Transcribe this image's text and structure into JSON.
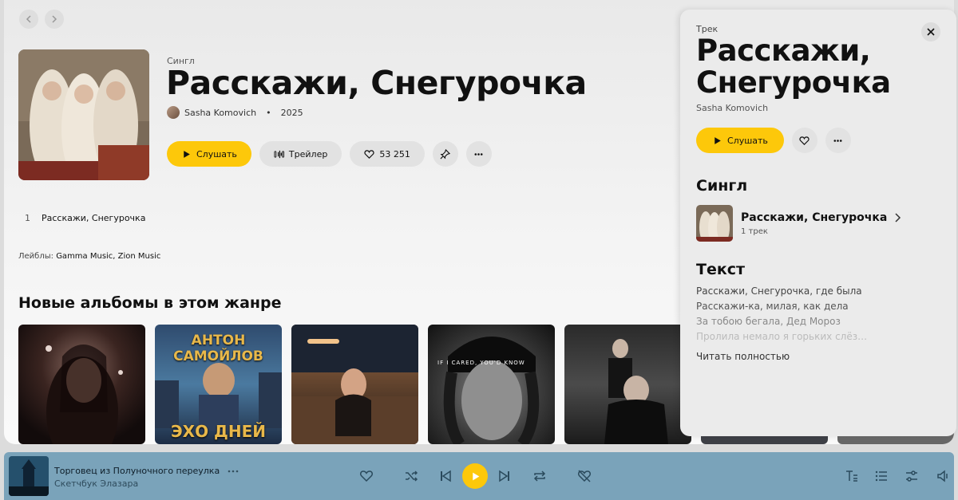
{
  "album": {
    "kicker": "Сингл",
    "title": "Расскажи, Снегурочка",
    "artist": "Sasha Komovich",
    "separator": "•",
    "year": "2025",
    "buttons": {
      "listen": "Слушать",
      "trailer": "Трейлер",
      "likes": "53 251"
    }
  },
  "tracks": [
    {
      "num": "1",
      "title": "Расскажи, Снегурочка"
    }
  ],
  "labels": {
    "prefix": "Лейблы:",
    "names": "Gamma Music, Zion Music"
  },
  "genre_section": {
    "title": "Новые альбомы в этом жанре",
    "albums": [
      {
        "name": "album-1"
      },
      {
        "name": "album-2",
        "cover_top": "АНТОН САМОЙЛОВ",
        "cover_bottom": "ЭХО ДНЕЙ"
      },
      {
        "name": "album-3"
      },
      {
        "name": "album-4",
        "cover_caption": "IF I CARED, YOU'D KNOW"
      },
      {
        "name": "album-5"
      }
    ]
  },
  "panel": {
    "kicker": "Трек",
    "title": "Расскажи, Снегурочка",
    "artist": "Sasha Komovich",
    "listen": "Слушать",
    "single_heading": "Сингл",
    "single_title": "Расскажи, Снегурочка",
    "single_count": "1 трек",
    "lyrics_heading": "Текст",
    "lyrics": [
      "Расскажи, Снегурочка, где была",
      "Расскажи-ка, милая, как дела",
      "За тобою бегала, Дед Мороз",
      "Пролила немало я горьких слёз…"
    ],
    "read_more": "Читать полностью"
  },
  "player": {
    "title": "Торговец из Полуночного переулка",
    "subtitle": "Скетчбук Элазара"
  },
  "colors": {
    "accent": "#fdc80a",
    "player_bg": "#7aa3ba"
  }
}
